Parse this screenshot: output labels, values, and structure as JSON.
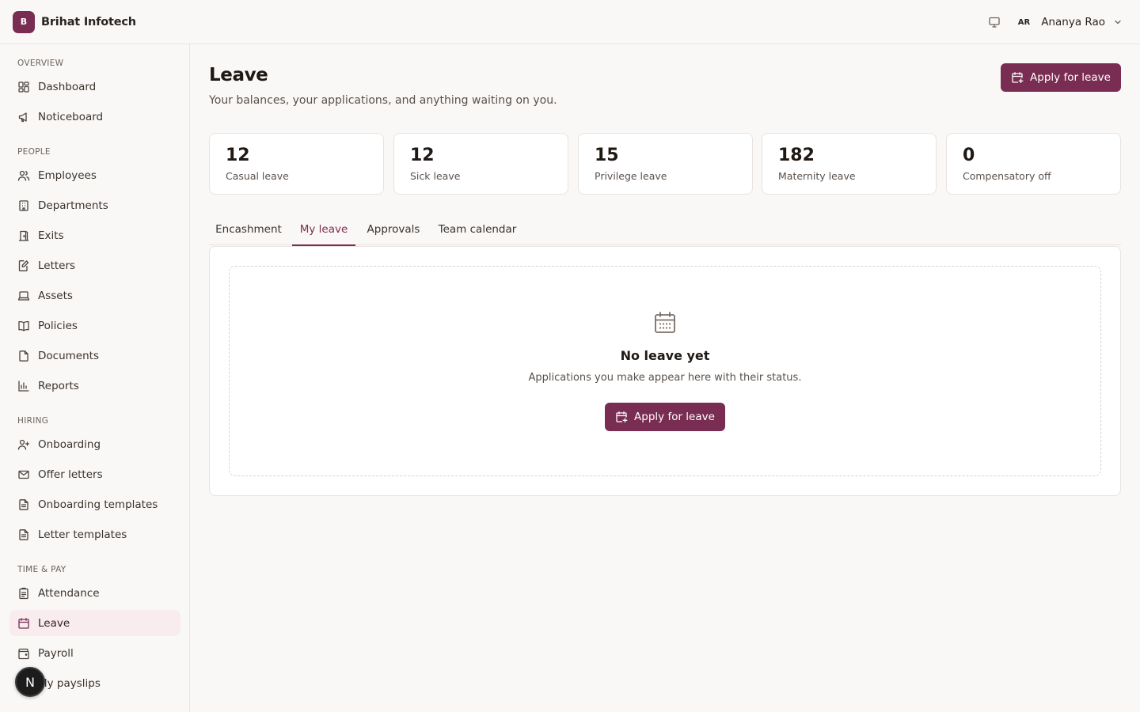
{
  "brand": {
    "initial": "B",
    "name": "Brihat Infotech"
  },
  "user": {
    "initials": "AR",
    "name": "Ananya Rao"
  },
  "sidebar": {
    "sections": [
      {
        "label": "OVERVIEW"
      },
      {
        "label": "PEOPLE"
      },
      {
        "label": "HIRING"
      },
      {
        "label": "TIME & PAY"
      }
    ],
    "items": [
      {
        "label": "Dashboard",
        "icon": "dashboard-icon"
      },
      {
        "label": "Noticeboard",
        "icon": "megaphone-icon"
      },
      {
        "label": "Employees",
        "icon": "users-icon"
      },
      {
        "label": "Departments",
        "icon": "building-icon"
      },
      {
        "label": "Exits",
        "icon": "door-icon"
      },
      {
        "label": "Letters",
        "icon": "edit-document-icon"
      },
      {
        "label": "Assets",
        "icon": "laptop-icon"
      },
      {
        "label": "Policies",
        "icon": "book-icon"
      },
      {
        "label": "Documents",
        "icon": "file-icon"
      },
      {
        "label": "Reports",
        "icon": "bar-chart-icon"
      },
      {
        "label": "Onboarding",
        "icon": "user-plus-icon"
      },
      {
        "label": "Offer letters",
        "icon": "mail-icon"
      },
      {
        "label": "Onboarding templates",
        "icon": "file-text-icon"
      },
      {
        "label": "Letter templates",
        "icon": "file-text-icon"
      },
      {
        "label": "Attendance",
        "icon": "clipboard-icon"
      },
      {
        "label": "Leave",
        "icon": "calendar-icon",
        "active": true
      },
      {
        "label": "Payroll",
        "icon": "wallet-icon"
      },
      {
        "label": "My payslips",
        "icon": "receipt-icon"
      }
    ]
  },
  "fab": {
    "letter": "N"
  },
  "page": {
    "title": "Leave",
    "subtitle": "Your balances, your applications, and anything waiting on you.",
    "apply_label": "Apply for leave"
  },
  "balances": [
    {
      "value": "12",
      "label": "Casual leave"
    },
    {
      "value": "12",
      "label": "Sick leave"
    },
    {
      "value": "15",
      "label": "Privilege leave"
    },
    {
      "value": "182",
      "label": "Maternity leave"
    },
    {
      "value": "0",
      "label": "Compensatory off"
    }
  ],
  "tabs": [
    {
      "label": "Encashment"
    },
    {
      "label": "My leave",
      "active": true
    },
    {
      "label": "Approvals"
    },
    {
      "label": "Team calendar"
    }
  ],
  "empty_state": {
    "title": "No leave yet",
    "description": "Applications you make appear here with their status.",
    "button_label": "Apply for leave"
  },
  "colors": {
    "accent": "#7a2d52",
    "active_bg": "#f8ecef",
    "background": "#faf8f6"
  }
}
